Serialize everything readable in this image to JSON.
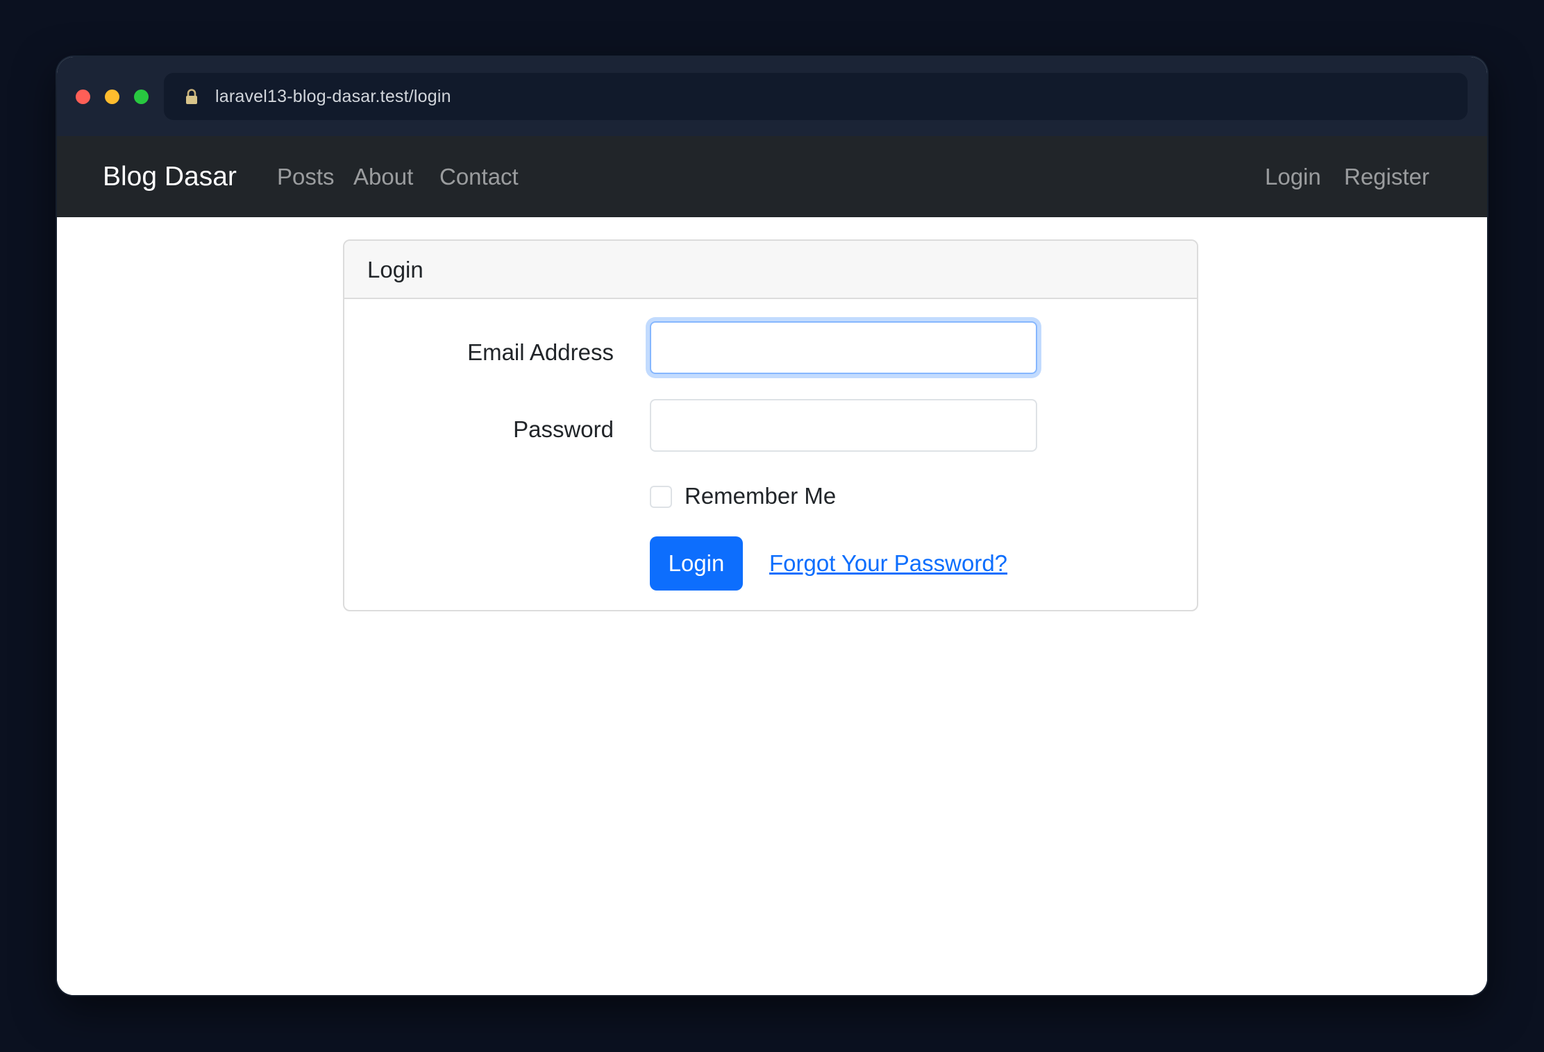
{
  "browser": {
    "url": "laravel13-blog-dasar.test/login",
    "lock_icon": "lock-icon"
  },
  "navbar": {
    "brand": "Blog Dasar",
    "links": [
      "Posts",
      "About",
      "Contact"
    ],
    "auth_links": [
      "Login",
      "Register"
    ]
  },
  "login_card": {
    "title": "Login",
    "email_label": "Email Address",
    "email_value": "",
    "password_label": "Password",
    "password_value": "",
    "remember_label": "Remember Me",
    "remember_checked": false,
    "submit_label": "Login",
    "forgot_label": "Forgot Your Password?"
  },
  "colors": {
    "navbar_bg": "#212529",
    "primary": "#0d6efd",
    "page_bg": "#0b1120"
  }
}
